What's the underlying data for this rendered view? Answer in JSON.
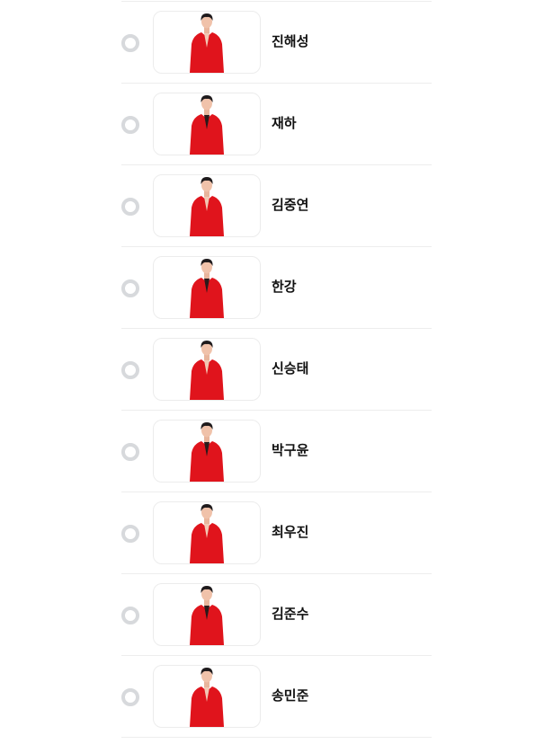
{
  "vote_list": {
    "accent_color": "#e0141c",
    "radio_color": "#d7d9dc",
    "candidates": [
      {
        "name": "진해성",
        "selected": false,
        "photo": "red-jacket-portrait"
      },
      {
        "name": "재하",
        "selected": false,
        "photo": "red-jacket-portrait"
      },
      {
        "name": "김중연",
        "selected": false,
        "photo": "red-jacket-portrait"
      },
      {
        "name": "한강",
        "selected": false,
        "photo": "red-jacket-portrait"
      },
      {
        "name": "신승태",
        "selected": false,
        "photo": "red-jacket-portrait"
      },
      {
        "name": "박구윤",
        "selected": false,
        "photo": "red-jacket-portrait"
      },
      {
        "name": "최우진",
        "selected": false,
        "photo": "red-jacket-portrait"
      },
      {
        "name": "김준수",
        "selected": false,
        "photo": "red-jacket-portrait"
      },
      {
        "name": "송민준",
        "selected": false,
        "photo": "red-jacket-portrait"
      }
    ]
  }
}
